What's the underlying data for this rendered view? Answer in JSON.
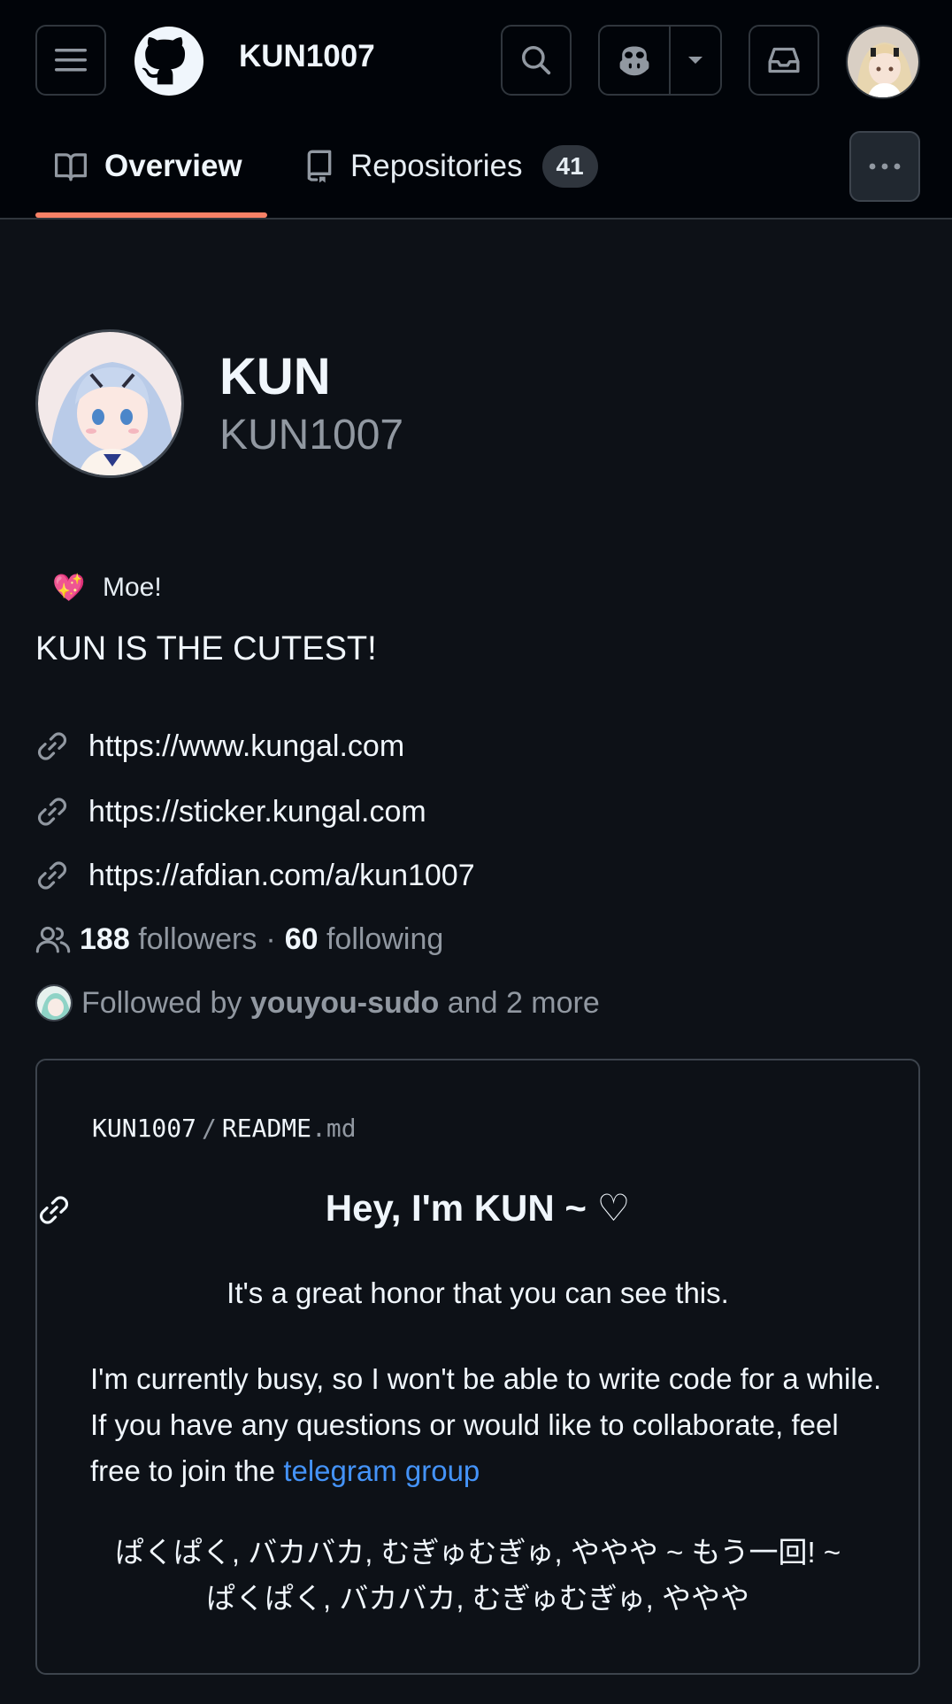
{
  "header": {
    "title": "KUN1007",
    "icons": {
      "menu": "hamburger-menu-icon",
      "logo": "github-logo-icon",
      "search": "search-icon",
      "copilot": "copilot-icon",
      "dropdown": "triangle-down-icon",
      "inbox": "inbox-icon"
    }
  },
  "tabs": [
    {
      "label": "Overview",
      "icon": "book-icon",
      "selected": true
    },
    {
      "label": "Repositories",
      "icon": "repo-icon",
      "count": "41"
    }
  ],
  "profile": {
    "name": "KUN",
    "login": "KUN1007",
    "status_emoji": "💖",
    "status_text": "Moe!",
    "bio": "KUN IS THE CUTEST!",
    "links": [
      "https://www.kungal.com",
      "https://sticker.kungal.com",
      "https://afdian.com/a/kun1007"
    ],
    "followers_count": "188",
    "followers_label": "followers",
    "separator": "·",
    "following_count": "60",
    "following_label": "following",
    "followed_by_prefix": "Followed by",
    "followed_by_user": "youyou-sudo",
    "followed_by_suffix": "and 2 more"
  },
  "readme": {
    "owner": "KUN1007",
    "separator": "/",
    "file_base": "README",
    "file_ext": ".md",
    "heading": "Hey, I'm KUN ~ ♡",
    "p1": "It's a great honor that you can see this.",
    "p2_text": "I'm currently busy, so I won't be able to write code for a while. If you have any questions or would like to collaborate, feel free to join the ",
    "p2_link": "telegram group",
    "p3_line1": "ぱくぱく, バカバカ, むぎゅむぎゅ, ややや ~ もう一回! ~",
    "p3_line2": "ぱくぱく, バカバカ, むぎゅむぎゅ, ややや"
  },
  "colors": {
    "background": "#0d1117",
    "header_bg": "#010409",
    "accent_underline": "#f78166",
    "link": "#4493f8",
    "muted": "#9198a1"
  }
}
